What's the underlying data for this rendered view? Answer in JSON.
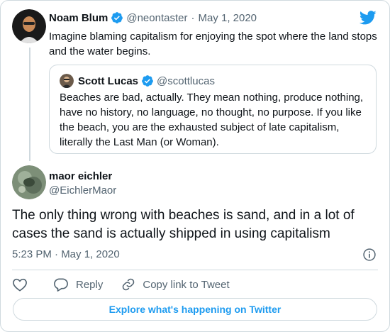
{
  "parent_tweet": {
    "name": "Noam Blum",
    "handle": "@neontaster",
    "separator": "·",
    "date": "May 1, 2020",
    "text": "Imagine blaming capitalism for enjoying the spot where the land stops and the water begins."
  },
  "quoted_tweet": {
    "name": "Scott Lucas",
    "handle": "@scottlucas",
    "text": "Beaches are bad, actually. They mean nothing, produce nothing, have no history, no language, no thought, no purpose. If you like the beach, you are the exhausted subject of late capitalism, literally the Last Man (or Woman)."
  },
  "main_tweet": {
    "name": "maor eichler",
    "handle": "@EichlerMaor",
    "text": "The only thing wrong with beaches is sand, and in a lot of cases the sand is actually shipped in using capitalism",
    "timestamp": "5:23 PM · May 1, 2020"
  },
  "actions": {
    "reply": "Reply",
    "copy_link": "Copy link to Tweet"
  },
  "explore_label": "Explore what's happening on Twitter",
  "colors": {
    "brand": "#1d9bf0",
    "text": "#0f1419",
    "muted": "#536471",
    "border": "#cfd9de"
  },
  "icons": [
    "twitter-bird-icon",
    "verified-badge-icon",
    "info-icon",
    "heart-icon",
    "reply-icon",
    "link-icon"
  ]
}
